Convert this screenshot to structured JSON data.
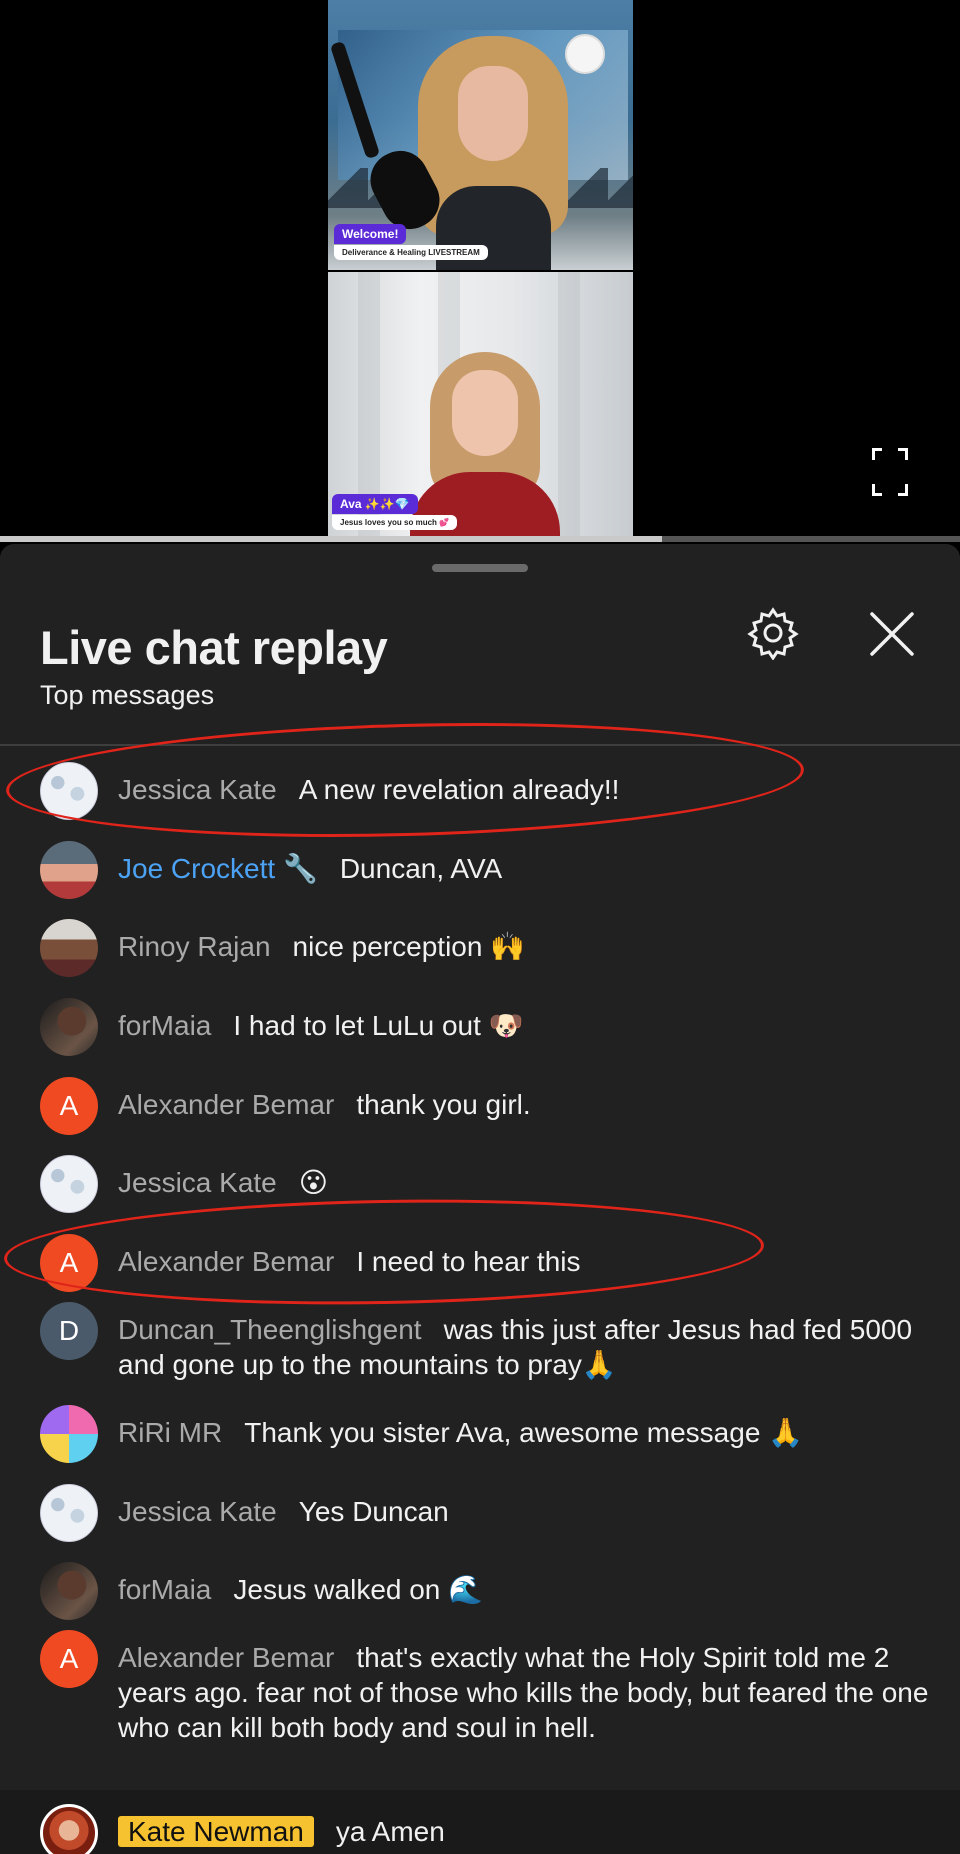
{
  "video": {
    "top_feed": {
      "tag": "Welcome!",
      "caption": "Deliverance & Healing LIVESTREAM"
    },
    "bottom_feed": {
      "tag": "Ava ✨✨💎",
      "caption": "Jesus loves you so much 💕"
    },
    "progress_fraction": 0.69
  },
  "chat": {
    "title": "Live chat replay",
    "subtitle": "Top messages",
    "settings_icon": "gear-icon",
    "close_icon": "close-icon",
    "messages": [
      {
        "author": "Jessica Kate",
        "text": "A new revelation already!!",
        "avatar": "doodle"
      },
      {
        "author": "Joe Crockett 🔧",
        "text": "Duncan, AVA",
        "avatar": "photo",
        "member": true
      },
      {
        "author": "Rinoy Rajan",
        "text": "nice perception 🙌",
        "avatar": "photo"
      },
      {
        "author": "forMaia",
        "text": "I had to let LuLu out 🐶",
        "avatar": "photo"
      },
      {
        "author": "Alexander Bemar",
        "text": "thank you girl.",
        "avatar_letter": "A"
      },
      {
        "author": "Jessica Kate",
        "text": "😮",
        "avatar": "doodle"
      },
      {
        "author": "Alexander Bemar",
        "text": "I need to hear this",
        "avatar_letter": "A"
      },
      {
        "author": "Duncan_Theenglishgent",
        "text": "was this just after Jesus had fed 5000 and gone up to the mountains to pray🙏",
        "avatar_letter": "D"
      },
      {
        "author": "RiRi MR",
        "text": "Thank you sister Ava, awesome message 🙏",
        "avatar": "photo"
      },
      {
        "author": "Jessica Kate",
        "text": "Yes Duncan",
        "avatar": "doodle"
      },
      {
        "author": "forMaia",
        "text": "Jesus walked on 🌊",
        "avatar": "photo"
      },
      {
        "author": "Alexander Bemar",
        "text": "that's exactly what the Holy Spirit told me 2 years ago. fear not of those who kills the body, but feared the one who can kill both body and soul in hell.",
        "avatar_letter": "A"
      },
      {
        "author": "Kate Newman",
        "text": "ya Amen",
        "avatar": "photo",
        "highlighted": true
      }
    ]
  },
  "colors": {
    "panel_bg": "#212121",
    "author_gray": "#aaaaaa",
    "member_blue": "#4ca2f5",
    "highlight_yellow": "#f7c22f",
    "annotation_red": "#e0241a"
  }
}
